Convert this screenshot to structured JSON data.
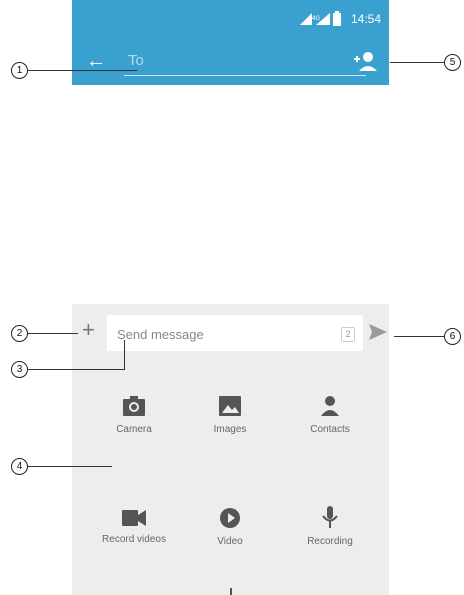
{
  "status_bar": {
    "time": "14:54",
    "network": "4G"
  },
  "header": {
    "to_placeholder": "To"
  },
  "compose": {
    "placeholder": "Send message",
    "counter": "2"
  },
  "attachments": [
    {
      "label": "Camera",
      "icon": "camera-icon"
    },
    {
      "label": "Images",
      "icon": "images-icon"
    },
    {
      "label": "Contacts",
      "icon": "contacts-icon"
    },
    {
      "label": "Record videos",
      "icon": "record-video-icon"
    },
    {
      "label": "Video",
      "icon": "video-play-icon"
    },
    {
      "label": "Recording",
      "icon": "microphone-icon"
    }
  ],
  "callouts": [
    "1",
    "2",
    "3",
    "4",
    "5",
    "6"
  ],
  "colors": {
    "accent": "#3aa0cf",
    "compose_bg": "#ededed",
    "icon": "#555555"
  }
}
